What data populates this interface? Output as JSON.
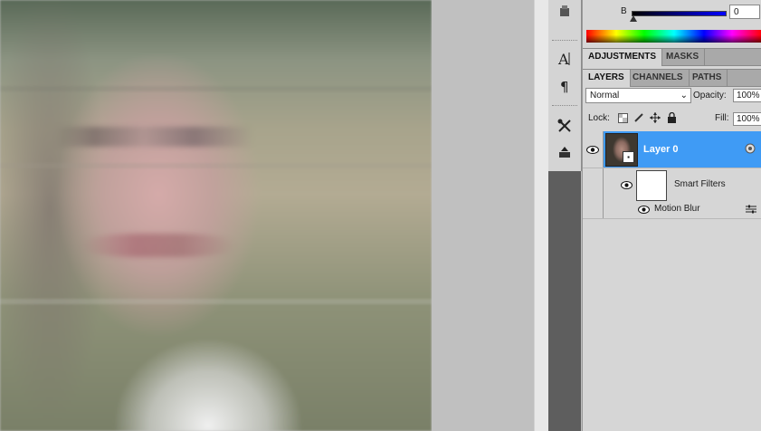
{
  "color_panel": {
    "channel_label": "B",
    "channel_value": "0"
  },
  "panel_tabs_top": [
    "ADJUSTMENTS",
    "MASKS"
  ],
  "panel_tabs_layers": [
    "LAYERS",
    "CHANNELS",
    "PATHS"
  ],
  "layers": {
    "blend_mode": "Normal",
    "opacity_label": "Opacity:",
    "opacity_value": "100%",
    "lock_label": "Lock:",
    "fill_label": "Fill:",
    "fill_value": "100%",
    "items": [
      {
        "name": "Layer 0",
        "selected": true
      },
      {
        "name": "Smart Filters"
      },
      {
        "name": "Motion Blur"
      }
    ]
  },
  "icons": [
    "character-icon",
    "paragraph-icon",
    "tools-icon",
    "stamp-icon",
    "eye-icon",
    "lock-transparency-icon",
    "lock-brush-icon",
    "lock-move-icon",
    "lock-all-icon",
    "filter-settings-icon"
  ],
  "colors": {
    "selection": "#3f9bf5",
    "panel": "#d6d6d6"
  }
}
